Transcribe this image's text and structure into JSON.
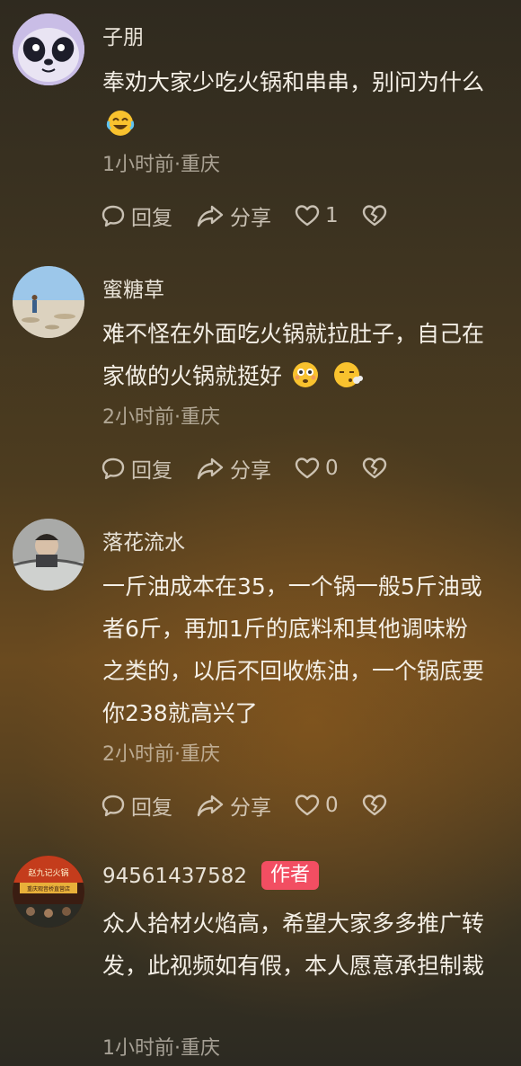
{
  "comments": [
    {
      "username": "子朋",
      "text": "奉劝大家少吃火锅和串串，别问为什么",
      "emoji": "face-with-tears-of-joy",
      "time": "1小时前",
      "location": "重庆",
      "reply_label": "回复",
      "share_label": "分享",
      "like_count": "1"
    },
    {
      "username": "蜜糖草",
      "text": "难不怪在外面吃火锅就拉肚子，自己在家做的火锅就挺好",
      "emoji": "flushed-face, face-exhaling",
      "time": "2小时前",
      "location": "重庆",
      "reply_label": "回复",
      "share_label": "分享",
      "like_count": "0"
    },
    {
      "username": "落花流水",
      "text": "一斤油成本在35，一个锅一般5斤油或者6斤，再加1斤的底料和其他调味粉之类的，以后不回收炼油，一个锅底要你238就高兴了",
      "time": "2小时前",
      "location": "重庆",
      "reply_label": "回复",
      "share_label": "分享",
      "like_count": "0"
    },
    {
      "username": "94561437582",
      "badge": "作者",
      "avatar_text": [
        "赵九记火锅",
        "重庆观音桥直营店"
      ],
      "text": "众人拾材火焰高，希望大家多多推广转发，此视频如有假，本人愿意承担制裁",
      "time": "1小时前",
      "location": "重庆"
    }
  ],
  "meta_separator": "·",
  "colors": {
    "author_badge": "#f24e62",
    "background_top": "#2f2a1f",
    "background_mid": "#6a4a1f"
  }
}
